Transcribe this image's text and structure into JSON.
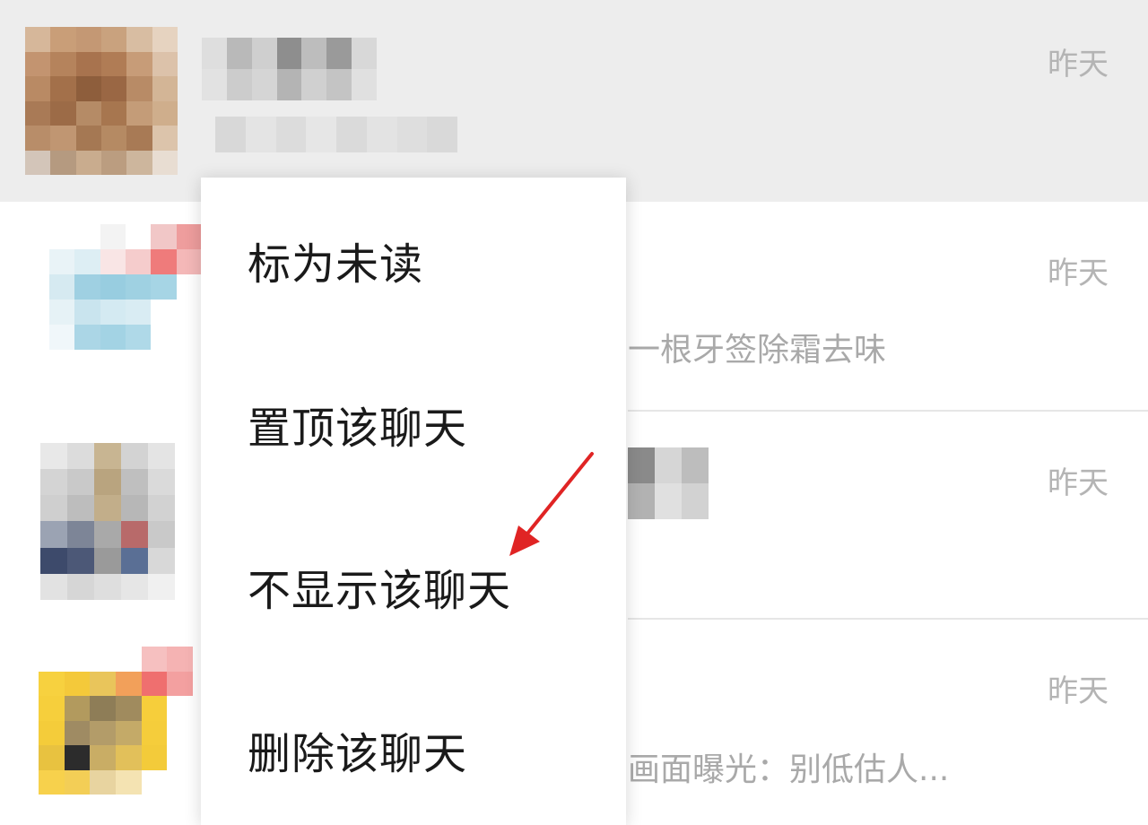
{
  "chat_list": {
    "rows": [
      {
        "time": "昨天",
        "preview": ""
      },
      {
        "time": "昨天",
        "preview": "一根牙签除霜去味"
      },
      {
        "time": "昨天",
        "preview": ""
      },
      {
        "time": "昨天",
        "preview": "画面曝光：别低估人..."
      }
    ]
  },
  "context_menu": {
    "items": [
      {
        "label": "标为未读"
      },
      {
        "label": "置顶该聊天"
      },
      {
        "label": "不显示该聊天"
      },
      {
        "label": "删除该聊天"
      }
    ]
  },
  "colors": {
    "selected_row_bg": "#ededed",
    "annotation_arrow": "#e02424",
    "time_text": "#b4b4b4",
    "preview_text": "#a9a9a9"
  }
}
